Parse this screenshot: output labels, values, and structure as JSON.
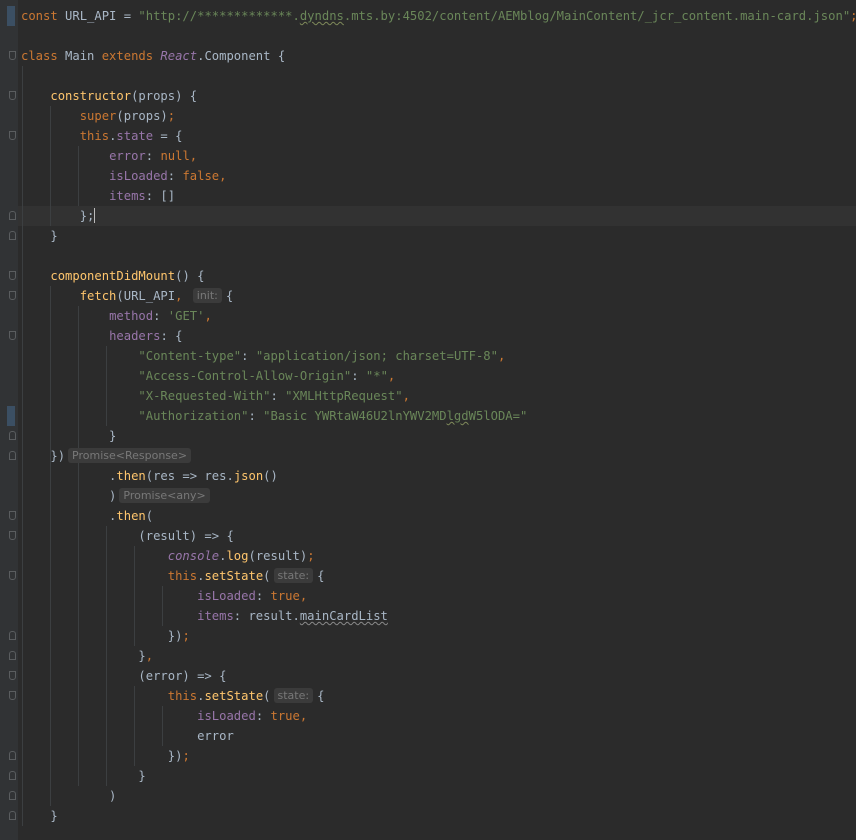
{
  "editor": {
    "lines": [
      [
        {
          "t": "const ",
          "c": "kw"
        },
        {
          "t": "URL_API = ",
          "c": ""
        },
        {
          "t": "\"http://*************.",
          "c": "str"
        },
        {
          "t": "dyndns",
          "c": "str squig"
        },
        {
          "t": ".mts.by:4502/content/AEMblog/MainContent/_jcr_content.main-card.json\"",
          "c": "str"
        },
        {
          "t": ";",
          "c": "kw"
        }
      ],
      [],
      [
        {
          "t": "class ",
          "c": "kw"
        },
        {
          "t": "Main ",
          "c": ""
        },
        {
          "t": "extends ",
          "c": "kw"
        },
        {
          "t": "React",
          "c": "it"
        },
        {
          "t": ".Component {",
          "c": ""
        }
      ],
      [],
      [
        {
          "t": "    ",
          "c": ""
        },
        {
          "t": "constructor",
          "c": "fn"
        },
        {
          "t": "(props) {",
          "c": ""
        }
      ],
      [
        {
          "t": "        ",
          "c": ""
        },
        {
          "t": "super",
          "c": "kw"
        },
        {
          "t": "(props)",
          "c": ""
        },
        {
          "t": ";",
          "c": "kw"
        }
      ],
      [
        {
          "t": "        ",
          "c": ""
        },
        {
          "t": "this",
          "c": "kw"
        },
        {
          "t": ".",
          "c": ""
        },
        {
          "t": "state",
          "c": "prop"
        },
        {
          "t": " = {",
          "c": ""
        }
      ],
      [
        {
          "t": "            ",
          "c": ""
        },
        {
          "t": "error",
          "c": "prop"
        },
        {
          "t": ": ",
          "c": ""
        },
        {
          "t": "null",
          "c": "kw"
        },
        {
          "t": ",",
          "c": "kw"
        }
      ],
      [
        {
          "t": "            ",
          "c": ""
        },
        {
          "t": "isLoaded",
          "c": "prop"
        },
        {
          "t": ": ",
          "c": ""
        },
        {
          "t": "false",
          "c": "kw"
        },
        {
          "t": ",",
          "c": "kw"
        }
      ],
      [
        {
          "t": "            ",
          "c": ""
        },
        {
          "t": "items",
          "c": "prop"
        },
        {
          "t": ": []",
          "c": ""
        }
      ],
      [
        {
          "t": "        };",
          "c": "caretline"
        }
      ],
      [
        {
          "t": "    }",
          "c": ""
        }
      ],
      [],
      [
        {
          "t": "    ",
          "c": ""
        },
        {
          "t": "componentDidMount",
          "c": "fn"
        },
        {
          "t": "() {",
          "c": ""
        }
      ],
      [
        {
          "t": "        ",
          "c": ""
        },
        {
          "t": "fetch",
          "c": "fn"
        },
        {
          "t": "(URL_API",
          "c": ""
        },
        {
          "t": ",",
          "c": "kw"
        },
        {
          "t": " ",
          "c": ""
        },
        {
          "t": "init:",
          "c": "hint"
        },
        {
          "t": "{",
          "c": ""
        }
      ],
      [
        {
          "t": "            ",
          "c": ""
        },
        {
          "t": "method",
          "c": "prop"
        },
        {
          "t": ": ",
          "c": ""
        },
        {
          "t": "'GET'",
          "c": "str"
        },
        {
          "t": ",",
          "c": "kw"
        }
      ],
      [
        {
          "t": "            ",
          "c": ""
        },
        {
          "t": "headers",
          "c": "prop"
        },
        {
          "t": ": {",
          "c": ""
        }
      ],
      [
        {
          "t": "                ",
          "c": ""
        },
        {
          "t": "\"Content-type\"",
          "c": "str"
        },
        {
          "t": ": ",
          "c": ""
        },
        {
          "t": "\"application/json; charset=UTF-8\"",
          "c": "str"
        },
        {
          "t": ",",
          "c": "kw"
        }
      ],
      [
        {
          "t": "                ",
          "c": ""
        },
        {
          "t": "\"Access-Control-Allow-Origin\"",
          "c": "str"
        },
        {
          "t": ": ",
          "c": ""
        },
        {
          "t": "\"*\"",
          "c": "str"
        },
        {
          "t": ",",
          "c": "kw"
        }
      ],
      [
        {
          "t": "                ",
          "c": ""
        },
        {
          "t": "\"X-Requested-With\"",
          "c": "str"
        },
        {
          "t": ": ",
          "c": ""
        },
        {
          "t": "\"XMLHttpRequest\"",
          "c": "str"
        },
        {
          "t": ",",
          "c": "kw"
        }
      ],
      [
        {
          "t": "                ",
          "c": ""
        },
        {
          "t": "\"Authorization\"",
          "c": "str"
        },
        {
          "t": ": ",
          "c": ""
        },
        {
          "t": "\"Basic YWRtaW46U2lnYWV2MD",
          "c": "str"
        },
        {
          "t": "lgd",
          "c": "str squig"
        },
        {
          "t": "W5lODA=\"",
          "c": "str"
        }
      ],
      [
        {
          "t": "            }",
          "c": ""
        }
      ],
      [
        {
          "t": "    ",
          "c": ""
        },
        {
          "t": "})",
          "c": ""
        },
        {
          "t": "Promise<Response>",
          "c": "hint"
        }
      ],
      [
        {
          "t": "            .",
          "c": ""
        },
        {
          "t": "then",
          "c": "fn"
        },
        {
          "t": "(res => res.",
          "c": ""
        },
        {
          "t": "json",
          "c": "fn"
        },
        {
          "t": "()",
          "c": ""
        }
      ],
      [
        {
          "t": "            )",
          "c": ""
        },
        {
          "t": "Promise<any>",
          "c": "hint"
        }
      ],
      [
        {
          "t": "            .",
          "c": ""
        },
        {
          "t": "then",
          "c": "fn"
        },
        {
          "t": "(",
          "c": ""
        }
      ],
      [
        {
          "t": "                (result) => {",
          "c": ""
        }
      ],
      [
        {
          "t": "                    ",
          "c": ""
        },
        {
          "t": "console",
          "c": "it"
        },
        {
          "t": ".",
          "c": ""
        },
        {
          "t": "log",
          "c": "fn"
        },
        {
          "t": "(result)",
          "c": ""
        },
        {
          "t": ";",
          "c": "kw"
        }
      ],
      [
        {
          "t": "                    ",
          "c": ""
        },
        {
          "t": "this",
          "c": "kw"
        },
        {
          "t": ".",
          "c": ""
        },
        {
          "t": "setState",
          "c": "fn"
        },
        {
          "t": "(",
          "c": ""
        },
        {
          "t": "state:",
          "c": "hint"
        },
        {
          "t": "{",
          "c": ""
        }
      ],
      [
        {
          "t": "                        ",
          "c": ""
        },
        {
          "t": "isLoaded",
          "c": "prop"
        },
        {
          "t": ": ",
          "c": ""
        },
        {
          "t": "true",
          "c": "kw"
        },
        {
          "t": ",",
          "c": "kw"
        }
      ],
      [
        {
          "t": "                        ",
          "c": ""
        },
        {
          "t": "items",
          "c": "prop"
        },
        {
          "t": ": result.",
          "c": ""
        },
        {
          "t": "mainCardList",
          "c": "squig-white"
        }
      ],
      [
        {
          "t": "                    })",
          "c": ""
        },
        {
          "t": ";",
          "c": "kw"
        }
      ],
      [
        {
          "t": "                }",
          "c": ""
        },
        {
          "t": ",",
          "c": "kw"
        }
      ],
      [
        {
          "t": "                (error) => {",
          "c": ""
        }
      ],
      [
        {
          "t": "                    ",
          "c": ""
        },
        {
          "t": "this",
          "c": "kw"
        },
        {
          "t": ".",
          "c": ""
        },
        {
          "t": "setState",
          "c": "fn"
        },
        {
          "t": "(",
          "c": ""
        },
        {
          "t": "state:",
          "c": "hint"
        },
        {
          "t": "{",
          "c": ""
        }
      ],
      [
        {
          "t": "                        ",
          "c": ""
        },
        {
          "t": "isLoaded",
          "c": "prop"
        },
        {
          "t": ": ",
          "c": ""
        },
        {
          "t": "true",
          "c": "kw"
        },
        {
          "t": ",",
          "c": "kw"
        }
      ],
      [
        {
          "t": "                        error",
          "c": ""
        }
      ],
      [
        {
          "t": "                    })",
          "c": ""
        },
        {
          "t": ";",
          "c": "kw"
        }
      ],
      [
        {
          "t": "                }",
          "c": ""
        }
      ],
      [
        {
          "t": "            )",
          "c": ""
        }
      ],
      [
        {
          "t": "    }",
          "c": ""
        }
      ]
    ]
  },
  "colors": {
    "background": "#2b2b2b",
    "gutter": "#313335",
    "keyword": "#cc7832",
    "string": "#6a8759",
    "property": "#9876aa",
    "function": "#ffc66d",
    "text": "#a9b7c6"
  }
}
